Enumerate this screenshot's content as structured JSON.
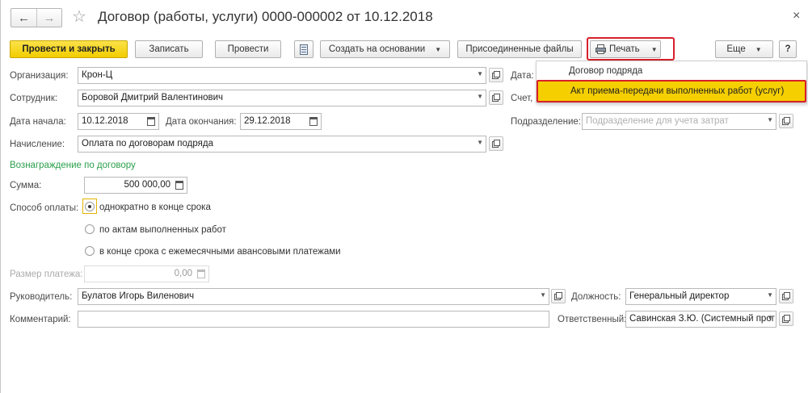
{
  "window": {
    "title": "Договор (работы, услуги) 0000-000002 от 10.12.2018",
    "back_icon": "←",
    "forward_icon": "→",
    "star_icon": "☆",
    "close_icon": "×"
  },
  "toolbar": {
    "post_close": "Провести и закрыть",
    "save": "Записать",
    "post": "Провести",
    "create_based": "Создать на основании",
    "attached_files": "Присоединенные файлы",
    "print": "Печать",
    "more": "Еще",
    "help": "?"
  },
  "print_menu": {
    "items": [
      "Договор подряда",
      "Акт приема-передачи выполненных работ (услуг)"
    ],
    "highlighted_index": 1
  },
  "form": {
    "organization": {
      "label": "Организация:",
      "value": "Крон-Ц"
    },
    "employee": {
      "label": "Сотрудник:",
      "value": "Боровой Дмитрий Валентинович"
    },
    "start_date": {
      "label": "Дата начала:",
      "value": "10.12.2018"
    },
    "end_date": {
      "label": "Дата окончания:",
      "value": "29.12.2018"
    },
    "accrual": {
      "label": "Начисление:",
      "value": "Оплата по договорам подряда"
    },
    "date_label": "Дата:",
    "account_label": "Счет,",
    "department": {
      "label": "Подразделение:",
      "placeholder": "Подразделение для учета затрат"
    },
    "section_title": "Вознаграждение по договору",
    "amount": {
      "label": "Сумма:",
      "value": "500 000,00"
    },
    "payment_method": {
      "label": "Способ оплаты:",
      "options": [
        "однократно в конце срока",
        "по актам выполненных работ",
        "в конце срока с ежемесячными авансовыми платежами"
      ],
      "selected_index": 0
    },
    "payment_size": {
      "label": "Размер платежа:",
      "value": "0,00"
    },
    "manager": {
      "label": "Руководитель:",
      "value": "Булатов Игорь Виленович"
    },
    "position": {
      "label": "Должность:",
      "value": "Генеральный директор"
    },
    "comment": {
      "label": "Комментарий:",
      "value": ""
    },
    "responsible": {
      "label": "Ответственный:",
      "value": "Савинская З.Ю. (Системный прог"
    }
  },
  "colors": {
    "primary_button": "#f2cd00",
    "highlight_border": "#d6202a",
    "section_title": "#2a9f4a"
  }
}
